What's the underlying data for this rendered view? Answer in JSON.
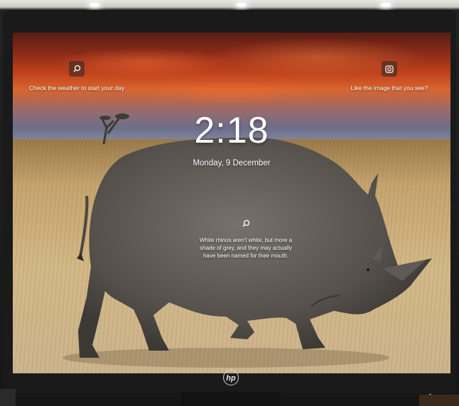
{
  "lock_screen": {
    "time": "2:18",
    "date": "Monday, 9 December"
  },
  "widgets": {
    "weather": {
      "text": "Check the weather to start your day",
      "icon": "search-icon"
    },
    "image_feedback": {
      "text": "Like the image that you see?",
      "icon": "camera-icon"
    },
    "fact": {
      "text": "White rhinos aren't white, but more a shade of grey, and they may actually have been named for their mouth.",
      "icon": "search-icon"
    }
  },
  "monitor": {
    "brand_logo": "hp"
  },
  "colors": {
    "sky_top": "#5a1d14",
    "sky_glow": "#d8652e",
    "grass": "#d3b987",
    "rhino": "#5b5753",
    "bezel": "#1a1a1b"
  }
}
